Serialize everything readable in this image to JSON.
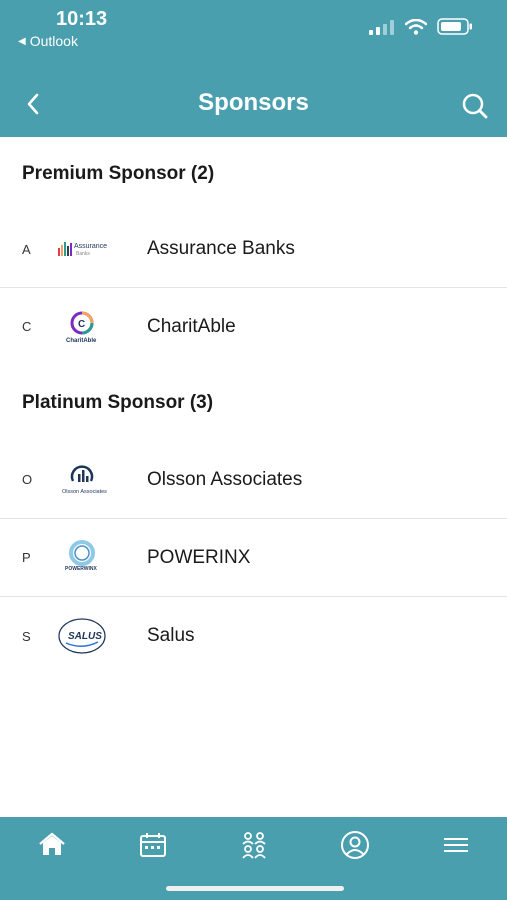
{
  "status": {
    "time": "10:13",
    "back_app": "Outlook"
  },
  "nav": {
    "title": "Sponsors"
  },
  "sections": [
    {
      "title": "Premium Sponsor (2)",
      "items": [
        {
          "letter": "A",
          "name": "Assurance Banks",
          "logo_text": "Assurance",
          "logo_sub": "Banks"
        },
        {
          "letter": "C",
          "name": "CharitAble",
          "logo_text": "CharitAble"
        }
      ]
    },
    {
      "title": "Platinum Sponsor (3)",
      "items": [
        {
          "letter": "O",
          "name": "Olsson Associates",
          "logo_text": "Olsson Associates"
        },
        {
          "letter": "P",
          "name": "POWERINX",
          "logo_text": "POWERWINX"
        },
        {
          "letter": "S",
          "name": "Salus",
          "logo_text": "SALUS"
        }
      ]
    }
  ],
  "tabs": [
    "home-icon",
    "calendar-icon",
    "people-icon",
    "profile-icon",
    "menu-icon"
  ],
  "colors": {
    "header": "#4a9fae",
    "text": "#1a1a1a"
  }
}
